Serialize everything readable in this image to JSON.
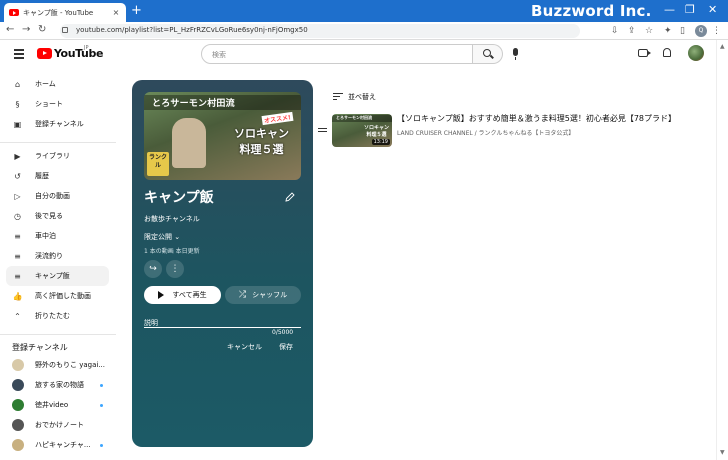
{
  "browser": {
    "tab_title": "キャンプ飯 - YouTube",
    "tab_close": "×",
    "new_tab": "+",
    "brand_watermark": "Buzzword Inc.",
    "url": "youtube.com/playlist?list=PL_HzFrRZCvLGoRue6sy0nj-nFjOmgx50",
    "profile_initial": "Q",
    "window_controls": [
      "—",
      "❐",
      "✕"
    ]
  },
  "youtube": {
    "logo_text": "YouTube",
    "logo_region": "JP",
    "search_placeholder": "検索"
  },
  "sidebar": {
    "main_items": [
      {
        "label": "ホーム",
        "icon": "home-icon"
      },
      {
        "label": "ショート",
        "icon": "shorts-icon"
      },
      {
        "label": "登録チャンネル",
        "icon": "subscriptions-icon"
      }
    ],
    "library_items": [
      {
        "label": "ライブラリ",
        "icon": "library-icon"
      },
      {
        "label": "履歴",
        "icon": "history-icon"
      },
      {
        "label": "自分の動画",
        "icon": "my-videos-icon"
      },
      {
        "label": "後で見る",
        "icon": "watch-later-icon"
      },
      {
        "label": "車中泊",
        "icon": "playlist-icon"
      },
      {
        "label": "渓流釣り",
        "icon": "playlist-icon"
      },
      {
        "label": "キャンプ飯",
        "icon": "playlist-icon",
        "active": true
      },
      {
        "label": "高く評価した動画",
        "icon": "like-icon"
      },
      {
        "label": "折りたたむ",
        "icon": "chevron-up-icon"
      }
    ],
    "subs_heading": "登録チャンネル",
    "subscriptions": [
      {
        "label": "野外のもりこ yagai...",
        "new": false,
        "color": "#d8c9a8"
      },
      {
        "label": "旅する家の物語",
        "new": true,
        "color": "#3a4a5a"
      },
      {
        "label": "徳井video",
        "new": true,
        "color": "#2e7d32"
      },
      {
        "label": "おでかけノート",
        "new": false,
        "color": "#555555"
      },
      {
        "label": "ハピキャンチャ...",
        "new": true,
        "color": "#c8b080"
      }
    ]
  },
  "playlist": {
    "thumb_title": "とろサーモン村田流",
    "thumb_tag": "オススメ!",
    "thumb_caption_1": "ソロキャン",
    "thumb_caption_2": "料理５選",
    "thumb_logo": "ランクル",
    "title": "キャンプ飯",
    "owner": "お散歩チャンネル",
    "privacy": "限定公開",
    "meta": "1 本の動画  本日更新",
    "share_icon": "↪",
    "more_icon": "⋮",
    "play_all": "すべて再生",
    "shuffle": "シャッフル",
    "description_label": "説明",
    "char_count": "0/5000",
    "cancel": "キャンセル",
    "save": "保存"
  },
  "list": {
    "sort_label": "並べ替え",
    "videos": [
      {
        "title": "【ソロキャンプ飯】おすすめ簡単＆激うま料理5選！初心者必見【78プラド】",
        "channel": "LAND CRUISER CHANNEL / ランクルちゃんねる【トヨタ公式】",
        "duration": "13:19",
        "thumb_line1": "とろサーモン村田流",
        "thumb_line2": "ソロキャン",
        "thumb_line3": "料理５選"
      }
    ]
  },
  "colors": {
    "accent_red": "#ff0000",
    "panel_bg": "#1d5560",
    "chrome_blue": "#1e6fcc",
    "subscription_new_dot": "#3ea6ff"
  }
}
